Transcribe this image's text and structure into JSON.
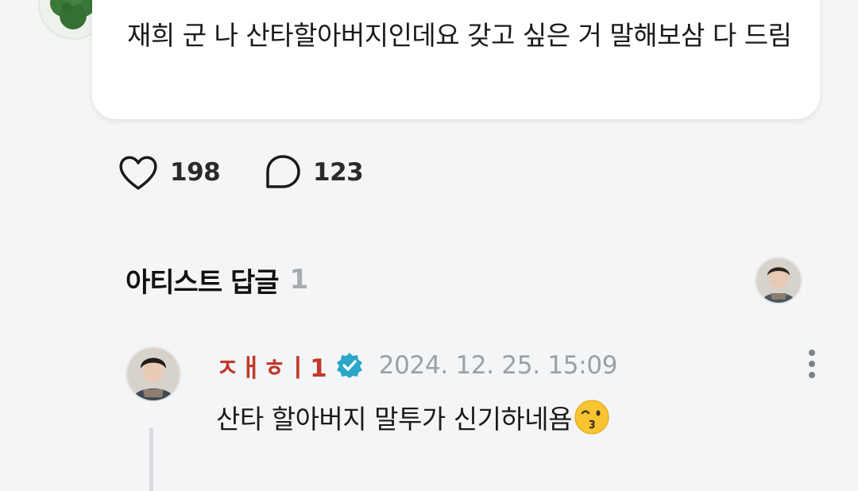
{
  "post": {
    "text": "재희 군 나 산타할아버지인데요 갖고 싶은 거 말해보삼 다 드림",
    "avatar_icon": "four-leaf-clover-icon"
  },
  "stats": {
    "likes": "198",
    "comments": "123",
    "like_icon": "heart-outline-icon",
    "comment_icon": "speech-bubble-icon"
  },
  "artist_replies": {
    "title": "아티스트 답글",
    "count": "1"
  },
  "reply": {
    "author": "ㅈㅐㅎㅣ1",
    "timestamp": "2024. 12. 25. 15:09",
    "text": "산타 할아버지 말투가 신기하네욤",
    "emoji": "kissing-face-emoji",
    "verified_icon": "verified-check-icon",
    "more_icon": "more-vertical-icon"
  },
  "colors": {
    "author_name": "#c0392b",
    "verified_badge": "#2aa7c9",
    "muted": "#9aa0a6",
    "background": "#f4f5f7",
    "card": "#ffffff"
  }
}
